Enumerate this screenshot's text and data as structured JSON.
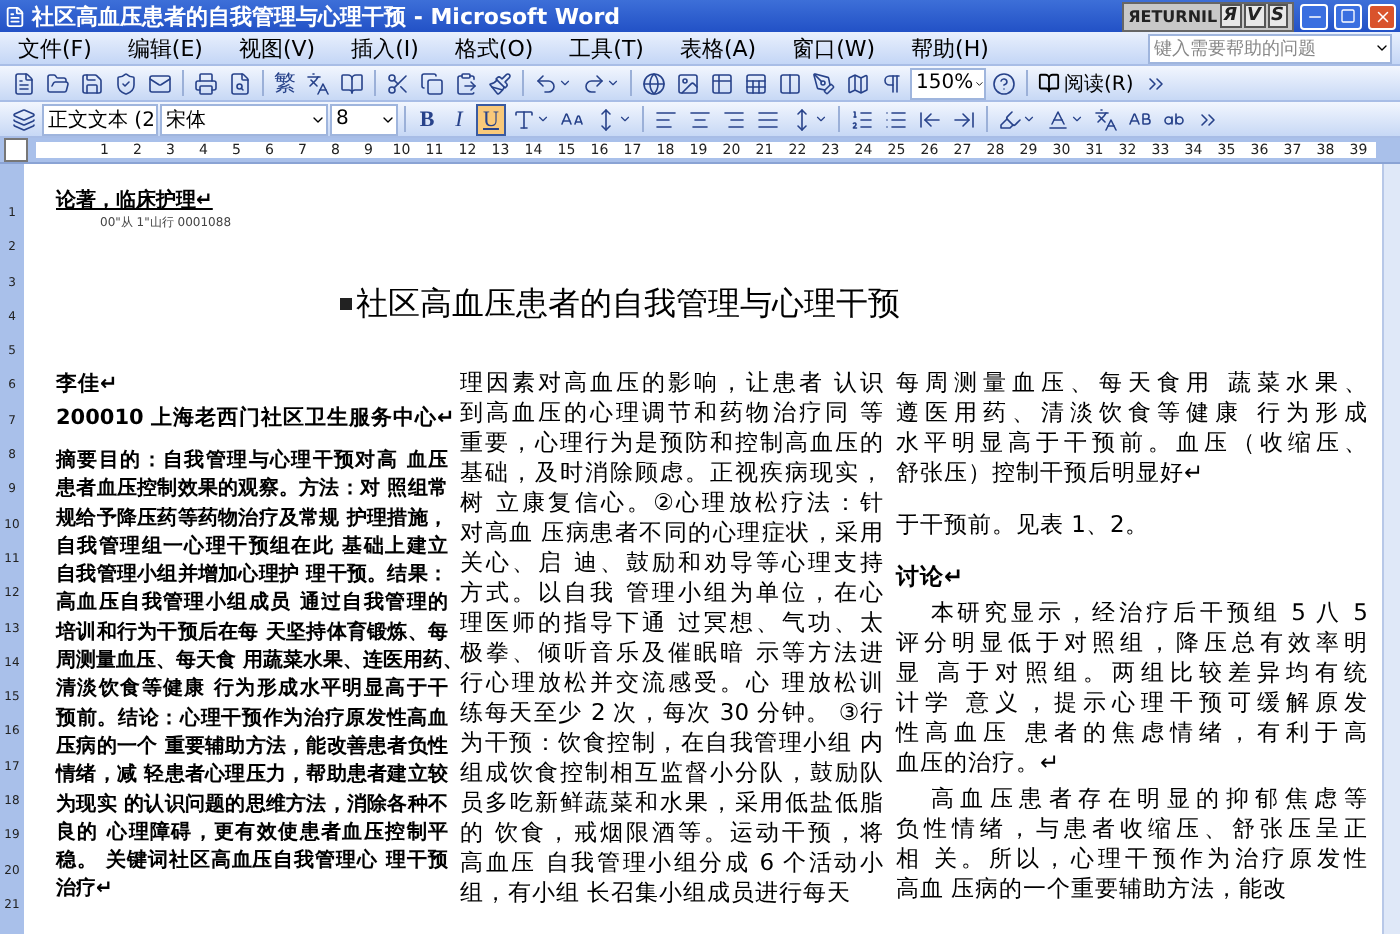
{
  "window": {
    "title": "社区高血压患者的自我管理与心理干预 - Microsoft Word"
  },
  "returnil": {
    "label": "ЯETURNIL",
    "keys": [
      "Я",
      "V",
      "S"
    ]
  },
  "menu": [
    {
      "label": "文件(F)"
    },
    {
      "label": "编辑(E)"
    },
    {
      "label": "视图(V)"
    },
    {
      "label": "插入(I)"
    },
    {
      "label": "格式(O)"
    },
    {
      "label": "工具(T)"
    },
    {
      "label": "表格(A)"
    },
    {
      "label": "窗口(W)"
    },
    {
      "label": "帮助(H)"
    }
  ],
  "help_search": {
    "placeholder": "键入需要帮助的问题"
  },
  "standard_toolbar": {
    "convert_label": "繁",
    "zoom": "150%",
    "read_button": "阅读(R)"
  },
  "format_toolbar": {
    "style": "正文文本 (2",
    "font": "宋体",
    "size": "8",
    "bold": {
      "label": "B",
      "on": false
    },
    "italic": {
      "label": "I",
      "on": false
    },
    "underline": {
      "label": "U",
      "on": true
    }
  },
  "ruler": {
    "labels": [
      "1",
      "2",
      "3",
      "4",
      "5",
      "6",
      "7",
      "8",
      "9",
      "10",
      "11",
      "12",
      "13",
      "14",
      "15",
      "16",
      "17",
      "18",
      "19",
      "20",
      "21",
      "22",
      "23",
      "24",
      "25",
      "26",
      "27",
      "28",
      "29",
      "30",
      "31",
      "32",
      "33",
      "34",
      "35",
      "36",
      "37",
      "38",
      "39"
    ]
  },
  "vertical_ruler": {
    "labels": [
      "1",
      "2",
      "3",
      "4",
      "5",
      "6",
      "7",
      "8",
      "9",
      "10",
      "11",
      "12",
      "13",
      "14",
      "15",
      "16",
      "17",
      "18",
      "19",
      "20",
      "21"
    ]
  },
  "document": {
    "section": "论著，临床护理↵",
    "code_line": "00\"从 1\"山行 0001088",
    "title": "社区高血压患者的自我管理与心理干预",
    "columns": [
      {
        "paragraphs": [
          {
            "kind": "author",
            "lines": [
              "李佳↵"
            ]
          },
          {
            "kind": "author",
            "lines": [
              "200010 上海老西门社区卫生服务中心↵"
            ]
          },
          {
            "kind": "abstract",
            "lines": [
              "摘要目的：自我管理与心理干预对高 血压",
              "患者血压控制效果的观察。方法：对 照组常",
              "规给予降压药等药物治疗及常规 护理措施，",
              "自我管理组一心理干预组在此 基础上建立",
              "自我管理小组并增加心理护 理干预。结果：",
              "高血压自我管理小组成员 通过自我管理的",
              "培训和行为干预后在每 天坚持体育锻炼、每",
              "周测量血压、每天食 用蔬菜水果、连医用药、",
              "清淡饮食等健康 行为形成水平明显高于干",
              "预前。结论：心理干预作为治疗原发性高血",
              "压病的一个 重要辅助方法，能改善患者负性",
              "情绪，减 轻患者心理压力，帮助患者建立较",
              "为现实 的认识问题的思维方法，消除各种不",
              "良的 心理障碍，更有效使患者血压控制平",
              "稳。 关键词社区高血压自我管理心 理干预",
              "治疗↵"
            ]
          }
        ]
      },
      {
        "paragraphs": [
          {
            "kind": "body",
            "lines": [
              "理因素对高血压的影响，让患者 认识",
              "到高血压的心理调节和药物治疗同 等",
              "重要，心理行为是预防和控制高血压的",
              "基础，及时消除顾虑。正视疾病现实，",
              "树 立康复信心。②心理放松疗法：针",
              "对高血 压病患者不同的心理症状，采用",
              "关心、启 迪、鼓励和劝导等心理支持",
              "方式。以自我 管理小组为单位，在心",
              "理医师的指导下通 过冥想、气功、太",
              "极拳、倾听音乐及催眠暗 示等方法进",
              "行心理放松并交流感受。心 理放松训",
              "练每天至少 2 次，每次 30 分钟。 ③行",
              "为干预：饮食控制，在自我管理小组 内",
              "组成饮食控制相互监督小分队，鼓励队",
              "员多吃新鲜蔬菜和水果，采用低盐低脂",
              "的 饮食，戒烟限酒等。运动干预，将",
              "高血压 自我管理小组分成 6 个活动小",
              "组，有小组 长召集小组成员进行每天"
            ]
          }
        ]
      },
      {
        "paragraphs": [
          {
            "kind": "body",
            "lines": [
              "每周测量血压、每天食用 蔬菜水果、",
              "遵医用药、清淡饮食等健康 行为形成",
              "水平明显高于干预前。血压（收缩压、",
              "舒张压）控制干预后明显好↵"
            ]
          },
          {
            "kind": "body",
            "lines": [
              "于干预前。见表 1、2。"
            ]
          },
          {
            "kind": "heading",
            "lines": [
              "讨论↵"
            ]
          },
          {
            "kind": "indented",
            "lines": [
              "本研究显示，经治疗后干预组 5 八 5",
              "评分明显低于对照组，降压总有效率明",
              "显 高于对照组。两组比较差异均有统",
              "计学 意义，提示心理干预可缓解原发",
              "性高血压 患者的焦虑情绪，有利于高",
              "血压的治疗。↵"
            ]
          },
          {
            "kind": "indented",
            "lines": [
              "高血压患者存在明显的抑郁焦虑等",
              "负性情绪，与患者收缩压、舒张压呈正",
              "相 关。所以，心理干预作为治疗原发性",
              "高血 压病的一个重要辅助方法，能改"
            ]
          }
        ]
      }
    ]
  }
}
